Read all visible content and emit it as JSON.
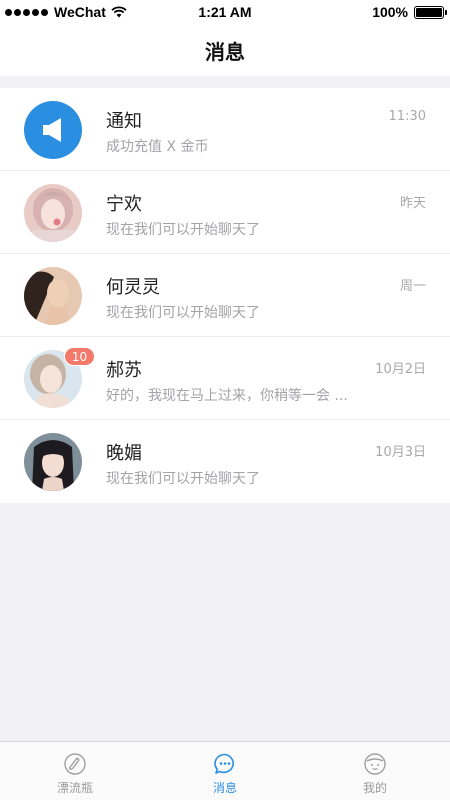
{
  "status_bar": {
    "carrier": "WeChat",
    "time": "1:21 AM",
    "battery": "100%",
    "battery_level": 1.0
  },
  "header": {
    "title": "消息"
  },
  "conversations": [
    {
      "name": "通知",
      "preview": "成功充值 X 金币",
      "time": "11:30",
      "avatar": "speaker-icon",
      "badge": ""
    },
    {
      "name": "宁欢",
      "preview": "现在我们可以开始聊天了",
      "time": "昨天",
      "avatar": "user-photo",
      "badge": ""
    },
    {
      "name": "何灵灵",
      "preview": "现在我们可以开始聊天了",
      "time": "周一",
      "avatar": "user-photo",
      "badge": ""
    },
    {
      "name": "郝苏",
      "preview": "好的，我现在马上过来，你稍等一会 ...",
      "time": "10月2日",
      "avatar": "user-photo",
      "badge": "10"
    },
    {
      "name": "晚媚",
      "preview": "现在我们可以开始聊天了",
      "time": "10月3日",
      "avatar": "user-photo",
      "badge": ""
    }
  ],
  "tab_bar": {
    "items": [
      {
        "label": "漂流瓶",
        "icon": "bottle-icon",
        "active": false
      },
      {
        "label": "消息",
        "icon": "chat-bubble-icon",
        "active": true
      },
      {
        "label": "我的",
        "icon": "profile-face-icon",
        "active": false
      }
    ]
  },
  "colors": {
    "accent": "#2a8fe0",
    "badge": "#f37a6a",
    "background": "#f2f2f6"
  }
}
